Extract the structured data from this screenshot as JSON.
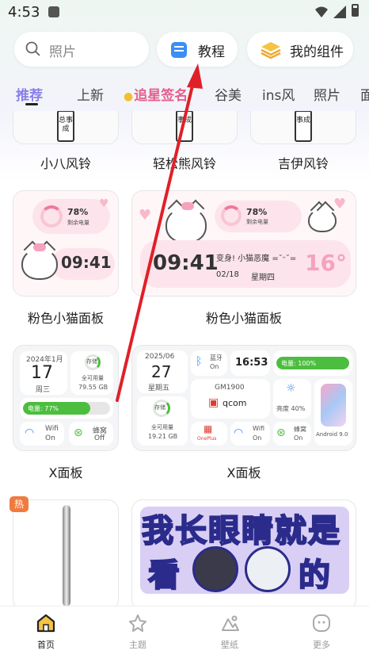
{
  "status_bar": {
    "time": "4:53"
  },
  "search": {
    "placeholder": "照片"
  },
  "quick_buttons": {
    "tutorial": "教程",
    "my_widgets": "我的组件"
  },
  "tabs": [
    "推荐",
    "上新",
    "追星签名",
    "谷美",
    "ins风",
    "照片",
    "面"
  ],
  "active_tab": "推荐",
  "grid": {
    "row1": [
      {
        "caption": "小八风铃",
        "chime_text": "总事成"
      },
      {
        "caption": "轻松熊风铃",
        "chime_text": "事成"
      },
      {
        "caption": "吉伊风铃",
        "chime_text": "事成"
      }
    ],
    "row2": {
      "left": {
        "caption": "粉色小猫面板",
        "battery_pct": "78%",
        "battery_label": "剩余电量",
        "time": "09:41"
      },
      "right": {
        "caption": "粉色小猫面板",
        "battery_pct": "78%",
        "battery_label": "剩余电量",
        "time": "09:41",
        "greeting": "变身! 小猫恶魔 =˘ᵕ˘=",
        "date": "02/18",
        "weekday": "星期四",
        "temp": "16°"
      }
    },
    "row3": {
      "left": {
        "caption": "X面板",
        "month": "2024年1月",
        "day": "17",
        "weekday": "周三",
        "storage_label": "存储",
        "storage_sub": "全可用量",
        "storage_val": "79.55 GB",
        "battery_text": "电量: 77%",
        "battery_fraction": 0.77,
        "wifi_label": "Wifi",
        "wifi_state": "On",
        "cell_label": "蜂窝",
        "cell_state": "Off"
      },
      "right": {
        "caption": "X面板",
        "month": "2025/06",
        "day": "27",
        "weekday": "星期五",
        "bt_label": "蓝牙",
        "bt_state": "On",
        "time": "16:53",
        "battery_text": "电量: 100%",
        "battery_fraction": 1.0,
        "model": "GM1900",
        "chip": "qcom",
        "brightness_label": "亮度 40%",
        "storage_label": "存储",
        "storage_sub": "全可用量",
        "storage_val": "19.21 GB",
        "brand": "OnePlus",
        "wifi_label": "Wifi",
        "wifi_state": "On",
        "cell_label": "蜂窝",
        "cell_state": "On",
        "android": "Android 9.0"
      }
    },
    "row4": {
      "hot_badge": "热",
      "banner_line1": "我长眼睛就是",
      "banner_line2_a": "看",
      "banner_line2_b": "的"
    }
  },
  "bottom_nav": [
    {
      "label": "首页",
      "icon": "home-icon",
      "active": true
    },
    {
      "label": "主题",
      "icon": "star-icon",
      "active": false
    },
    {
      "label": "壁纸",
      "icon": "wallpaper-icon",
      "active": false
    },
    {
      "label": "更多",
      "icon": "more-icon",
      "active": false
    }
  ],
  "colors": {
    "accent": "#8a80e8",
    "tutorial_blue": "#3a8ef6",
    "hot": "#f07b3f",
    "battery_green": "#4cbe3f",
    "arrow_red": "#e02028"
  }
}
